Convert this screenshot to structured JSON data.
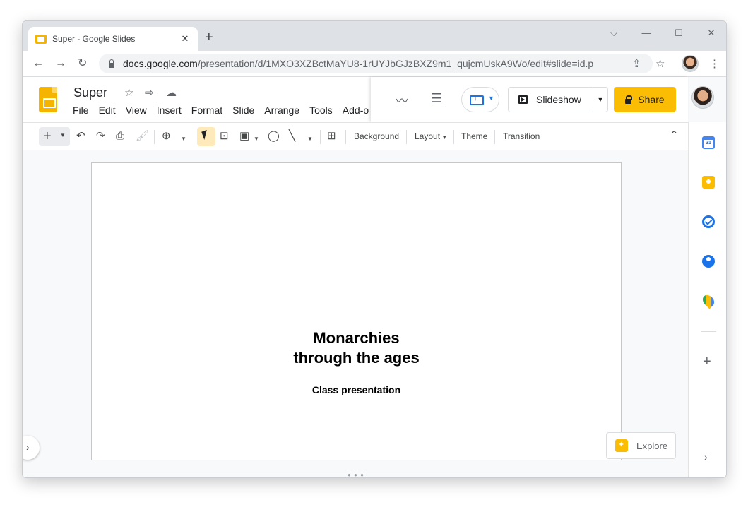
{
  "browser": {
    "tab_title": "Super - Google Slides",
    "tab_close": "✕",
    "new_tab": "+",
    "window_controls": {
      "collapse": "⌵",
      "minimize": "—",
      "maximize": "☐",
      "close": "✕"
    },
    "url_host": "docs.google.com",
    "url_path": "/presentation/d/1MXO3XZBctMaYU8-1rUYJbGJzBXZ9m1_qujcmUskA9Wo/edit#slide=id.p"
  },
  "app": {
    "doc_title": "Super",
    "menu": [
      "File",
      "Edit",
      "View",
      "Insert",
      "Format",
      "Slide",
      "Arrange",
      "Tools",
      "Add-o"
    ],
    "slideshow_label": "Slideshow",
    "share_label": "Share",
    "accent_color": "#fbbc04"
  },
  "toolbar": {
    "background_label": "Background",
    "layout_label": "Layout",
    "theme_label": "Theme",
    "transition_label": "Transition"
  },
  "sidepanel": {
    "calendar_day": "31"
  },
  "slide": {
    "title": "Monarchies\nthrough the ages",
    "subtitle": "Class presentation"
  },
  "explore": {
    "label": "Explore"
  }
}
